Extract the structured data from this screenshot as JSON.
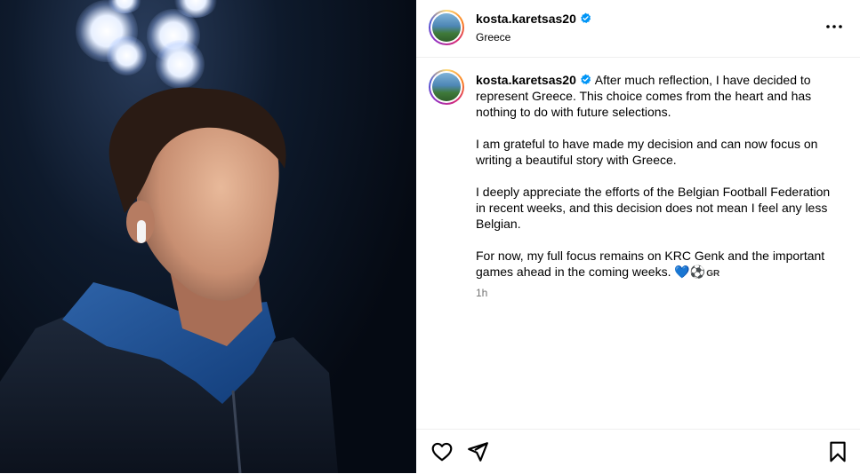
{
  "post": {
    "author": "kosta.karetsas20",
    "location": "Greece",
    "caption": {
      "first_line": "After much reflection, I have decided to represent Greece. This choice comes from the heart and has nothing to do with future selections.",
      "p2": "I am grateful to have made my decision and can now focus on writing a beautiful story with Greece.",
      "p3": "I deeply appreciate the efforts of the Belgian Football Federation in recent weeks, and this decision does not mean I feel any less Belgian.",
      "p4": "For now, my full focus remains on KRC Genk and the important games ahead in the coming weeks.",
      "emoji_heart": "💙",
      "emoji_ball": "⚽",
      "flag_text": "GR"
    },
    "timestamp": "1h"
  },
  "icons": {
    "verified": "verified-badge-icon",
    "more": "more-options-icon",
    "like": "heart-icon",
    "share": "send-icon",
    "save": "bookmark-icon"
  },
  "colors": {
    "verified": "#0095f6",
    "muted_text": "#737373",
    "divider": "#efefef"
  }
}
